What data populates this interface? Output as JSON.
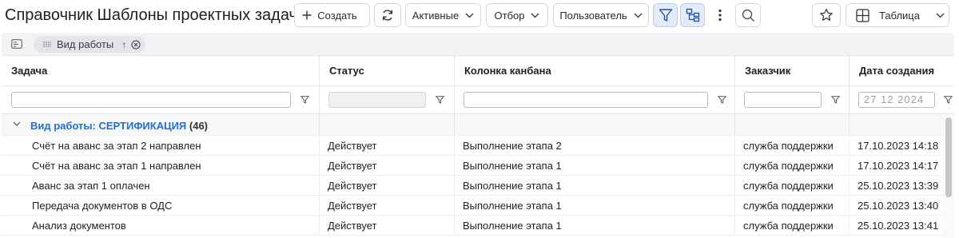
{
  "toolbar": {
    "title": "Справочник Шаблоны проектных задач",
    "create_label": "Создать",
    "active_label": "Активные",
    "filter_label": "Отбор",
    "user_label": "Пользователь",
    "view_label": "Таблица"
  },
  "grouping": {
    "chip_label": "Вид работы",
    "sort_arrow": "↑"
  },
  "table": {
    "columns": [
      "Задача",
      "Статус",
      "Колонка канбана",
      "Заказчик",
      "Дата создания"
    ],
    "filters": {
      "date_placeholder": "27 12 2024"
    },
    "group": {
      "label": "Вид работы: СЕРТИФИКАЦИЯ",
      "count": "(46)"
    },
    "rows": [
      [
        "Счёт на аванс за этап 2 направлен",
        "Действует",
        "Выполнение этапа 2",
        "служба поддержки",
        "17.10.2023 14:18"
      ],
      [
        "Счёт на аванс за этап 1 направлен",
        "Действует",
        "Выполнение этапа 1",
        "служба поддержки",
        "17.10.2023 14:17"
      ],
      [
        "Аванс за этап 1 оплачен",
        "Действует",
        "Выполнение этапа 1",
        "служба поддержки",
        "25.10.2023 13:39"
      ],
      [
        "Передача документов в ОДС",
        "Действует",
        "Выполнение этапа 1",
        "служба поддержки",
        "25.10.2023 13:40"
      ],
      [
        "Анализ документов",
        "Действует",
        "Выполнение этапа 1",
        "служба поддержки",
        "25.10.2023 13:41"
      ]
    ]
  },
  "colors": {
    "accent": "#1f6fd6",
    "active_button_bg": "#e3ecfb"
  },
  "icons": [
    "plus-icon",
    "refresh-icon",
    "chevron-down-icon",
    "filter-icon",
    "tree-icon",
    "more-vertical-icon",
    "search-icon",
    "star-icon",
    "table-grid-icon",
    "group-panel-icon",
    "drag-handle-icon",
    "close-circle-icon"
  ]
}
